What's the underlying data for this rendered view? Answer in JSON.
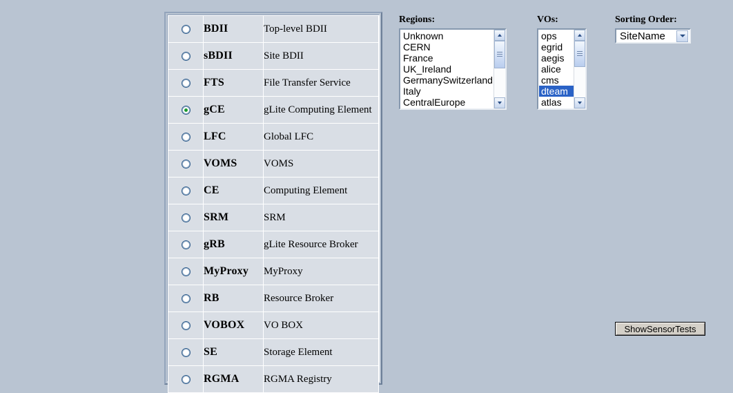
{
  "page": {
    "background_color": "#b9c4d2"
  },
  "service_table": {
    "selected_code": "gCE",
    "rows": [
      {
        "code": "BDII",
        "description": "Top-level BDII",
        "selected": false
      },
      {
        "code": "sBDII",
        "description": "Site BDII",
        "selected": false
      },
      {
        "code": "FTS",
        "description": "File Transfer Service",
        "selected": false
      },
      {
        "code": "gCE",
        "description": "gLite Computing Element",
        "selected": true
      },
      {
        "code": "LFC",
        "description": "Global LFC",
        "selected": false
      },
      {
        "code": "VOMS",
        "description": "VOMS",
        "selected": false
      },
      {
        "code": "CE",
        "description": "Computing Element",
        "selected": false
      },
      {
        "code": "SRM",
        "description": "SRM",
        "selected": false
      },
      {
        "code": "gRB",
        "description": "gLite Resource Broker",
        "selected": false
      },
      {
        "code": "MyProxy",
        "description": "MyProxy",
        "selected": false
      },
      {
        "code": "RB",
        "description": "Resource Broker",
        "selected": false
      },
      {
        "code": "VOBOX",
        "description": "VO BOX",
        "selected": false
      },
      {
        "code": "SE",
        "description": "Storage Element",
        "selected": false
      },
      {
        "code": "RGMA",
        "description": "RGMA Registry",
        "selected": false
      }
    ]
  },
  "regions": {
    "label": "Regions:",
    "options": [
      {
        "label": "Unknown",
        "selected": false
      },
      {
        "label": "CERN",
        "selected": false
      },
      {
        "label": "France",
        "selected": false
      },
      {
        "label": "UK_Ireland",
        "selected": false
      },
      {
        "label": "GermanySwitzerland",
        "selected": false
      },
      {
        "label": "Italy",
        "selected": false
      },
      {
        "label": "CentralEurope",
        "selected": false
      }
    ]
  },
  "vos": {
    "label": "VOs:",
    "selected_value": "dteam",
    "options": [
      {
        "label": "ops",
        "selected": false
      },
      {
        "label": "egrid",
        "selected": false
      },
      {
        "label": "aegis",
        "selected": false
      },
      {
        "label": "alice",
        "selected": false
      },
      {
        "label": "cms",
        "selected": false
      },
      {
        "label": "dteam",
        "selected": true
      },
      {
        "label": "atlas",
        "selected": false
      }
    ],
    "selection_color": "#2a62c6"
  },
  "sorting_order": {
    "label": "Sorting Order:",
    "value": "SiteName"
  },
  "actions": {
    "show_sensor_tests_label": "ShowSensorTests"
  }
}
